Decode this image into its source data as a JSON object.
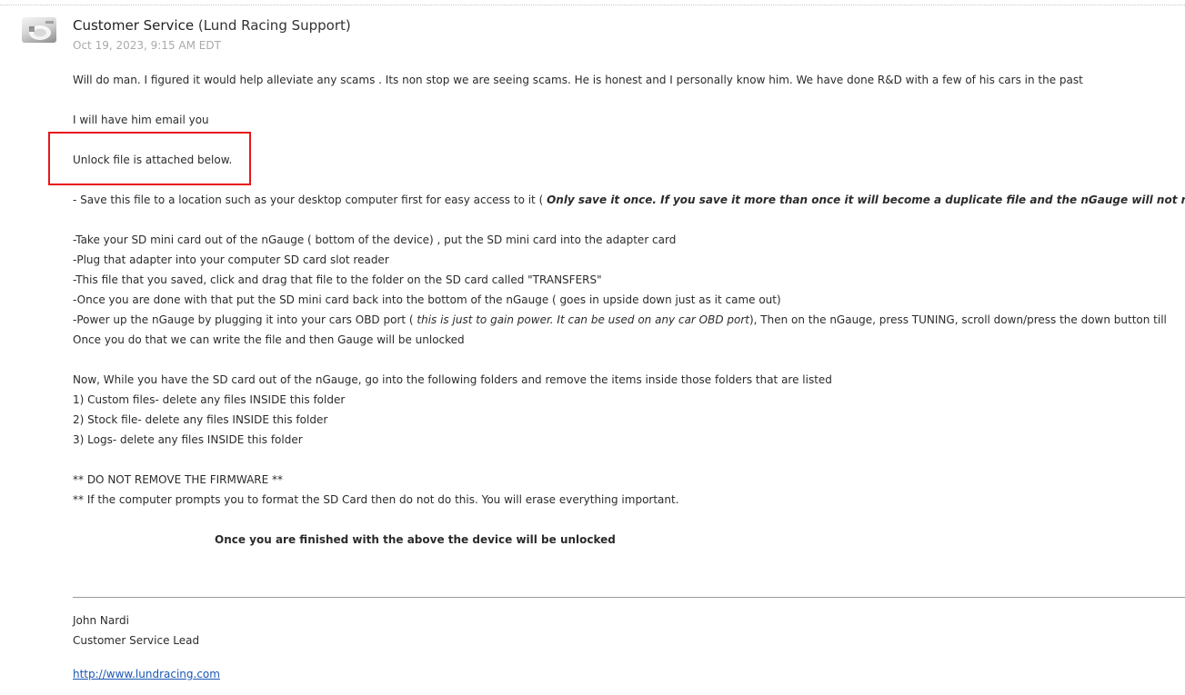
{
  "message": {
    "sender_name": "Customer Service",
    "sender_org": "(Lund Racing Support)",
    "date": "Oct 19, 2023, 9:15 AM EDT"
  },
  "body": {
    "p1": "Will do man. I figured it would help alleviate any scams . Its non stop we are seeing scams. He is honest and I personally know him. We have done R&D with a few of his cars in the past",
    "p2": "I will have him email you",
    "p3": "Unlock file is attached below.",
    "save_prefix": "- Save this file to a location such as your desktop computer first for easy access to it ( ",
    "save_bold": "Only save it once. If you save it more than once it will become a duplicate file and the nGauge will not r",
    "step1": "-Take your SD mini card out of the nGauge ( bottom of the device) , put the SD mini card into the adapter card",
    "step2": "-Plug that adapter into your computer SD card slot reader",
    "step3": "-This file that you saved, click and drag that file to the folder on the SD card called \"TRANSFERS\"",
    "step4": "-Once you are done with that put the SD mini card back into the bottom of the nGauge ( goes in upside down just as it came out)",
    "step5_prefix": "-Power up the nGauge by plugging it into your cars OBD port ( ",
    "step5_italic": "this is just to gain power. It can be used on any car OBD port",
    "step5_suffix": "), Then on the nGauge, press TUNING, scroll down/press the down button till",
    "step6": "Once you do that we can write the file and then Gauge will be unlocked",
    "folders_intro": "Now, While you have the SD card out of the nGauge, go into the following folders and remove the items inside those folders that are listed",
    "folder1": "1) Custom files- delete any files INSIDE this folder",
    "folder2": "2) Stock file- delete any files INSIDE this folder",
    "folder3": "3) Logs- delete any files INSIDE this folder",
    "warn1": "** DO NOT REMOVE THE FIRMWARE **",
    "warn2": "** If the computer prompts you to format the SD Card then do not do this. You will erase everything important.",
    "final": "Once you are finished with the above the device will be unlocked"
  },
  "signature": {
    "name": "John Nardi",
    "title": "Customer Service Lead",
    "link": "http://www.lundracing.com"
  },
  "colors": {
    "highlight_box": "#e8161b",
    "link": "#1a57b5",
    "date": "#aaaaaa"
  }
}
